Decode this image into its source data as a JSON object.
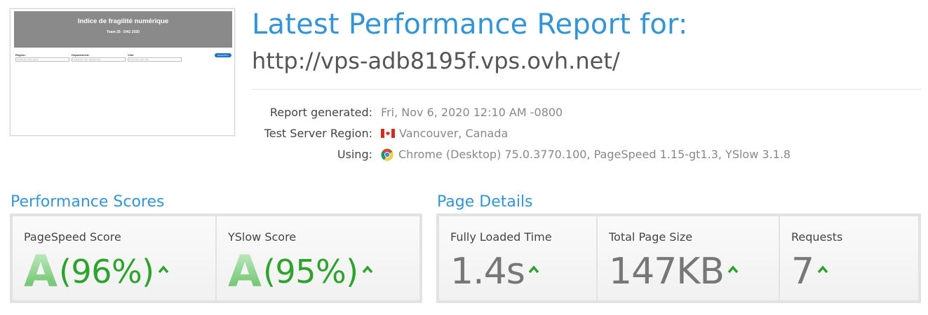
{
  "thumbnail": {
    "title": "Indice de fragilité numérique",
    "subtitle": "Team 25 - D4G 2020",
    "fields": [
      {
        "label": "Région:",
        "placeholder": "Choisissez votre région"
      },
      {
        "label": "Département:",
        "placeholder": "Choisissez votre département"
      },
      {
        "label": "Ville:",
        "placeholder": "Choisissez votre ville"
      }
    ],
    "button": "Rechercher"
  },
  "header": {
    "title": "Latest Performance Report for:",
    "url": "http://vps-adb8195f.vps.ovh.net/"
  },
  "meta": {
    "report_generated": {
      "label": "Report generated:",
      "value": "Fri, Nov 6, 2020 12:10 AM -0800"
    },
    "region": {
      "label": "Test Server Region:",
      "value": "Vancouver, Canada",
      "flag_icon": "canada-flag-icon"
    },
    "using": {
      "label": "Using:",
      "value": "Chrome (Desktop) 75.0.3770.100, PageSpeed 1.15-gt1.3, YSlow 3.1.8",
      "browser_icon": "chrome-icon"
    }
  },
  "performance": {
    "heading": "Performance Scores",
    "pagespeed": {
      "label": "PageSpeed Score",
      "grade": "A",
      "percent": "(96%)"
    },
    "yslow": {
      "label": "YSlow Score",
      "grade": "A",
      "percent": "(95%)"
    }
  },
  "details": {
    "heading": "Page Details",
    "load_time": {
      "label": "Fully Loaded Time",
      "value": "1.4s"
    },
    "page_size": {
      "label": "Total Page Size",
      "value": "147KB"
    },
    "requests": {
      "label": "Requests",
      "value": "7"
    }
  },
  "colors": {
    "accent": "#3395d8",
    "grade_green": "#2ca42c"
  }
}
